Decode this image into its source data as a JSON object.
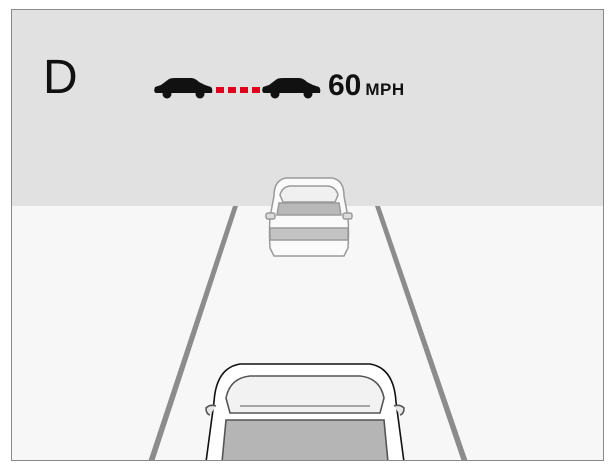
{
  "cluster": {
    "gear": "D",
    "set_speed": "60",
    "speed_unit": "MPH",
    "following_gap_icon": "car-gap-car-icon",
    "gap_indicator_color": "#e0001b"
  }
}
